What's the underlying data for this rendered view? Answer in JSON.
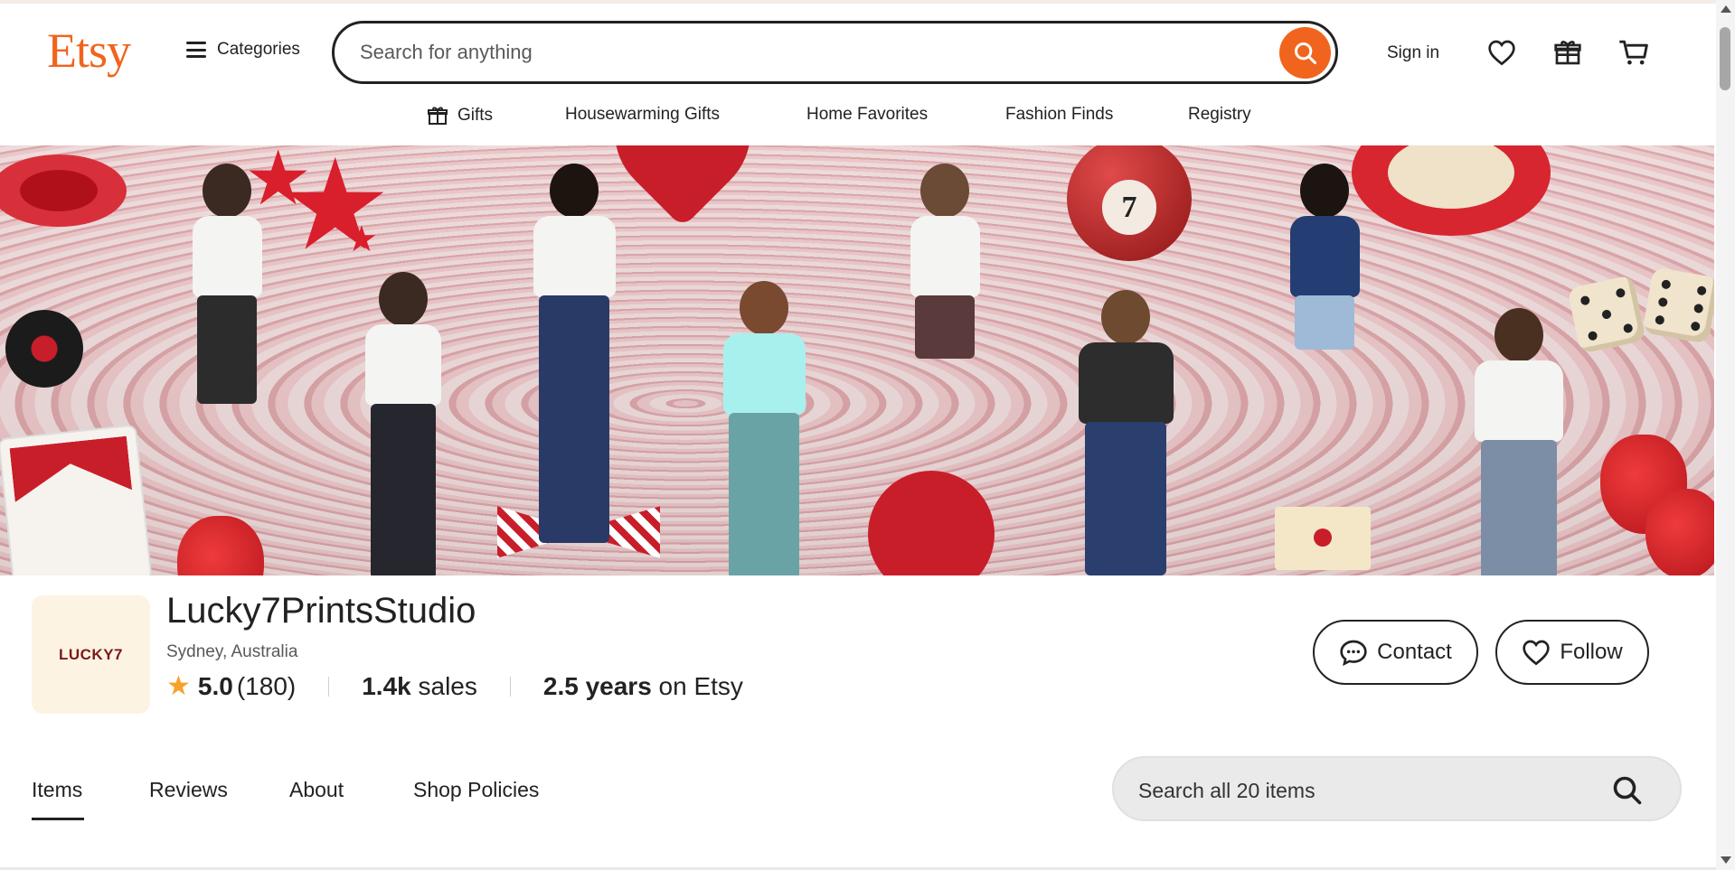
{
  "header": {
    "logo": "Etsy",
    "categories_label": "Categories",
    "search_placeholder": "Search for anything",
    "signin_label": "Sign in",
    "icons": [
      "search-icon",
      "heart-icon",
      "gift-icon",
      "cart-icon"
    ]
  },
  "nav": {
    "items": [
      "Gifts",
      "Housewarming Gifts",
      "Home Favorites",
      "Fashion Finds",
      "Registry"
    ]
  },
  "banner": {
    "ball_number": "7"
  },
  "shop": {
    "logo_text": "LUCKY7",
    "name": "Lucky7PrintsStudio",
    "location": "Sydney, Australia",
    "rating": "5.0",
    "review_count": "(180)",
    "sales_value": "1.4k",
    "sales_label": "sales",
    "years_value": "2.5 years",
    "years_label": "on Etsy"
  },
  "actions": {
    "contact_label": "Contact",
    "follow_label": "Follow"
  },
  "tabs": {
    "items": [
      "Items",
      "Reviews",
      "About",
      "Shop Policies"
    ],
    "active": "Items",
    "search_placeholder": "Search all 20 items"
  },
  "colors": {
    "brand": "#f1641e",
    "star": "#f7a12a",
    "text": "#222222"
  }
}
